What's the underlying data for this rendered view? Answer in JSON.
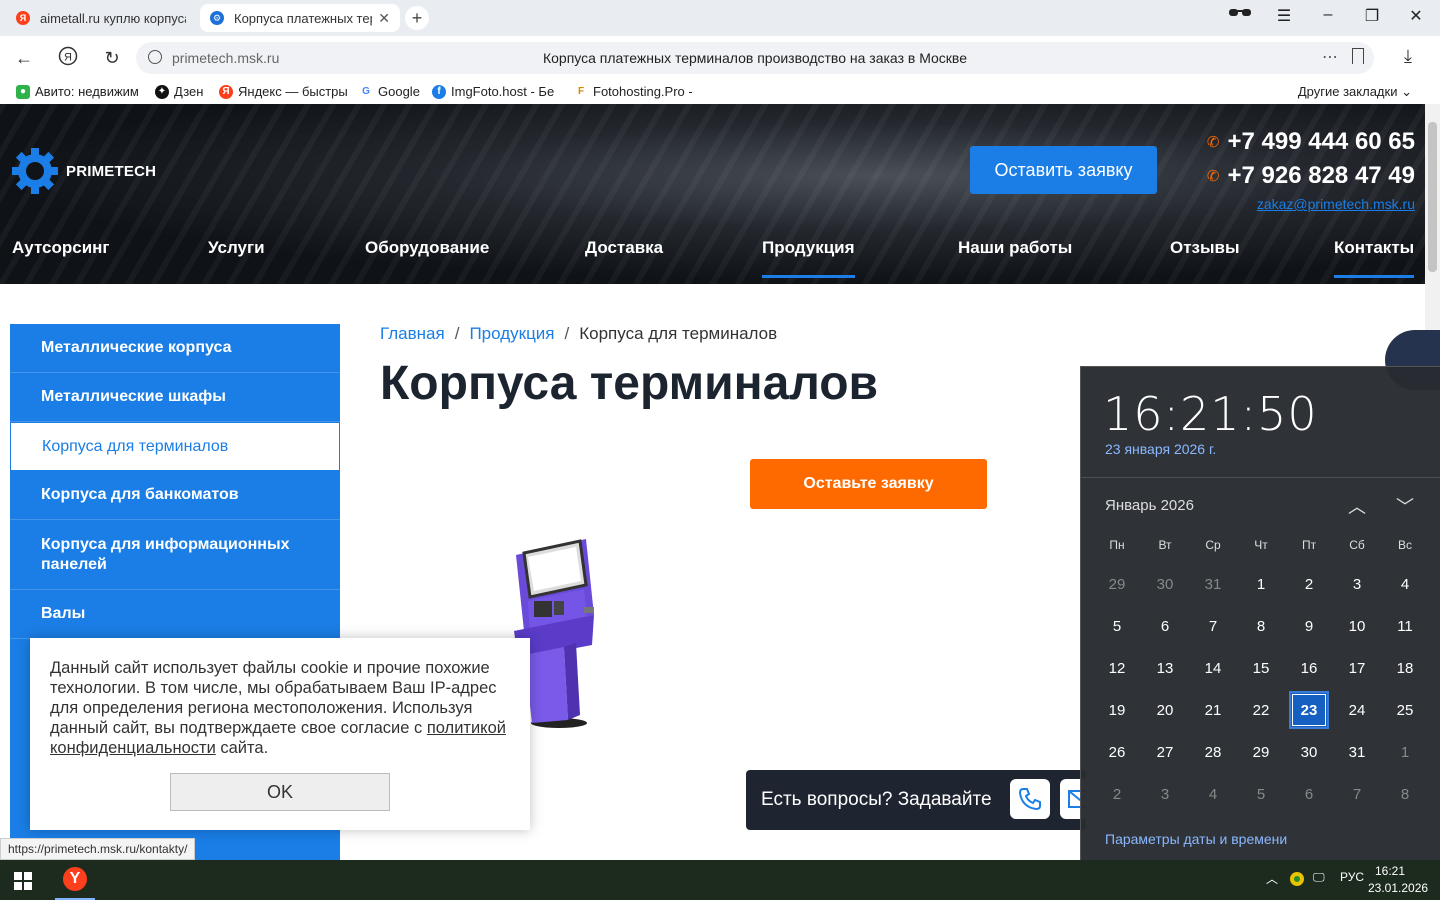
{
  "browser": {
    "tabs": [
      {
        "title": "aimetall.ru куплю корпуса",
        "favicon": "yandex-icon"
      },
      {
        "title": "Корпуса платежных терминалов",
        "favicon": "gear-icon"
      }
    ],
    "host": "primetech.msk.ru",
    "page_title": "Корпуса платежных терминалов производство на заказ в Москве",
    "bookmarks": [
      "Авито: недвижим",
      "Дзен",
      "Яндекс — быстры",
      "Google",
      "ImgFoto.host - Бе",
      "Fotohosting.Pro -"
    ],
    "other_bookmarks": "Другие закладки",
    "status_url": "https://primetech.msk.ru/kontakty/"
  },
  "site": {
    "logo": "PRIMETECH",
    "cta_top": "Оставить заявку",
    "phones": [
      "+7 499 444 60 65",
      "+7 926 828 47 49"
    ],
    "email": "zakaz@primetech.msk.ru",
    "nav": [
      "Аутсорсинг",
      "Услуги",
      "Оборудование",
      "Доставка",
      "Продукция",
      "Наши работы",
      "Отзывы",
      "Контакты"
    ],
    "nav_active": "Продукция",
    "accent": "#1a7ee6",
    "orange": "#ff6a00"
  },
  "sidebar": [
    "Металлические корпуса",
    "Металлические шкафы",
    "Корпуса для терминалов",
    "Корпуса для банкоматов",
    "Корпуса для информационных панелей",
    "Валы"
  ],
  "content": {
    "crumbs": [
      "Главная",
      "Продукция",
      "Корпуса для терминалов"
    ],
    "crumb_sep": "/",
    "heading": "Корпуса терминалов",
    "order_button": "Оставьте заявку",
    "questions": "Есть вопросы? Задавайте"
  },
  "cookie": {
    "text": "Данный сайт использует файлы cookie и прочие похожие технологии. В том числе, мы обрабатываем Ваш IP-адрес для определения региона местоположения. Используя данный сайт, вы подтверждаете свое согласие с ",
    "link": "политикой конфиденциальности",
    "text_end": " сайта.",
    "ok": "OK"
  },
  "clock": {
    "time": "16:21:50",
    "date": "23 января 2026 г.",
    "month": "Январь 2026",
    "weekdays": [
      "Пн",
      "Вт",
      "Ср",
      "Чт",
      "Пт",
      "Сб",
      "Вс"
    ],
    "weeks": [
      [
        "29",
        "30",
        "31",
        "1",
        "2",
        "3",
        "4"
      ],
      [
        "5",
        "6",
        "7",
        "8",
        "9",
        "10",
        "11"
      ],
      [
        "12",
        "13",
        "14",
        "15",
        "16",
        "17",
        "18"
      ],
      [
        "19",
        "20",
        "21",
        "22",
        "23",
        "24",
        "25"
      ],
      [
        "26",
        "27",
        "28",
        "29",
        "30",
        "31",
        "1"
      ],
      [
        "2",
        "3",
        "4",
        "5",
        "6",
        "7",
        "8"
      ]
    ],
    "today": "23",
    "params": "Параметры даты и времени"
  },
  "taskbar": {
    "lang": "РУС",
    "time": "16:21",
    "date": "23.01.2026"
  }
}
